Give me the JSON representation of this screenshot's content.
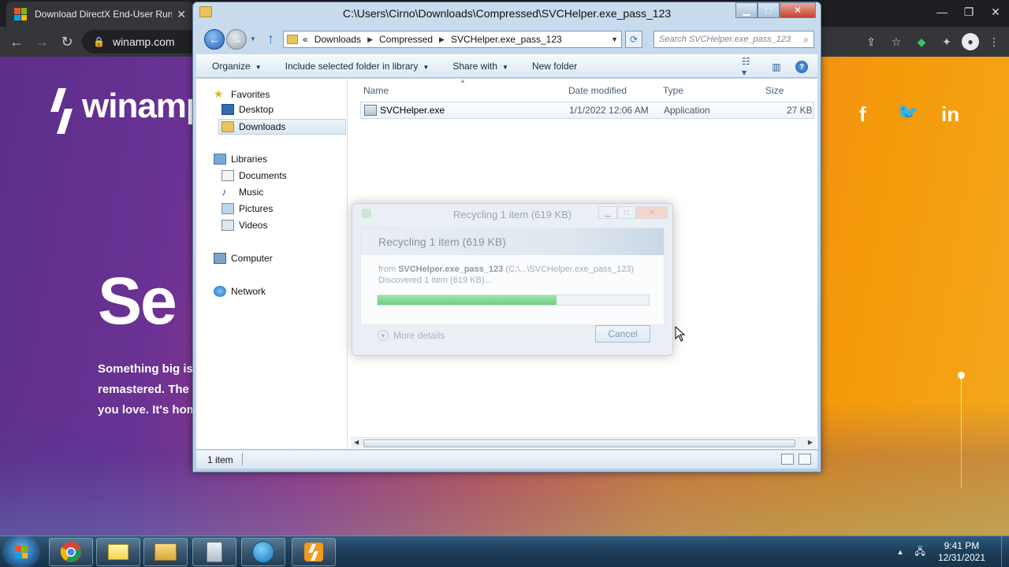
{
  "browser": {
    "tab_title": "Download DirectX End-User Runtim",
    "tab_close": "✕",
    "address": "winamp.com",
    "win_controls": [
      "—",
      "❐",
      "✕"
    ]
  },
  "page": {
    "logo_text": "winamp",
    "hero_text": "Se",
    "blurb_lines": [
      "Something big is",
      "remastered. The",
      "you love. It's hom"
    ],
    "social": [
      "f",
      "🐦",
      "in"
    ]
  },
  "explorer": {
    "title": "C:\\Users\\Cirno\\Downloads\\Compressed\\SVCHelper.exe_pass_123",
    "breadcrumb": [
      "«",
      "Downloads",
      "Compressed",
      "SVCHelper.exe_pass_123"
    ],
    "search_placeholder": "Search SVCHelper.exe_pass_123",
    "commands": [
      "Organize",
      "Include selected folder in library",
      "Share with",
      "New folder"
    ],
    "nav": {
      "favorites": "Favorites",
      "desktop": "Desktop",
      "downloads": "Downloads",
      "libraries": "Libraries",
      "documents": "Documents",
      "music": "Music",
      "pictures": "Pictures",
      "videos": "Videos",
      "computer": "Computer",
      "network": "Network"
    },
    "columns": [
      "Name",
      "Date modified",
      "Type",
      "Size"
    ],
    "files": [
      {
        "name": "SVCHelper.exe",
        "date": "1/1/2022 12:06 AM",
        "type": "Application",
        "size": "27 KB"
      }
    ],
    "status": "1 item"
  },
  "dialog": {
    "title": "Recycling 1 item (619 KB)",
    "heading": "Recycling 1 item (619 KB)",
    "from_prefix": "from",
    "from_name": "SVCHelper.exe_pass_123",
    "from_path": "(C:\\...\\SVCHelper.exe_pass_123)",
    "discovered": "Discovered 1 item (619 KB)...",
    "progress_fraction": 0.66,
    "more_details": "More details",
    "cancel": "Cancel"
  },
  "taskbar": {
    "time": "9:41 PM",
    "date": "12/31/2021"
  },
  "colors": {
    "win_red": "#f25022",
    "win_green": "#7fba00",
    "win_blue": "#00a4ef",
    "win_yellow": "#ffb900"
  }
}
